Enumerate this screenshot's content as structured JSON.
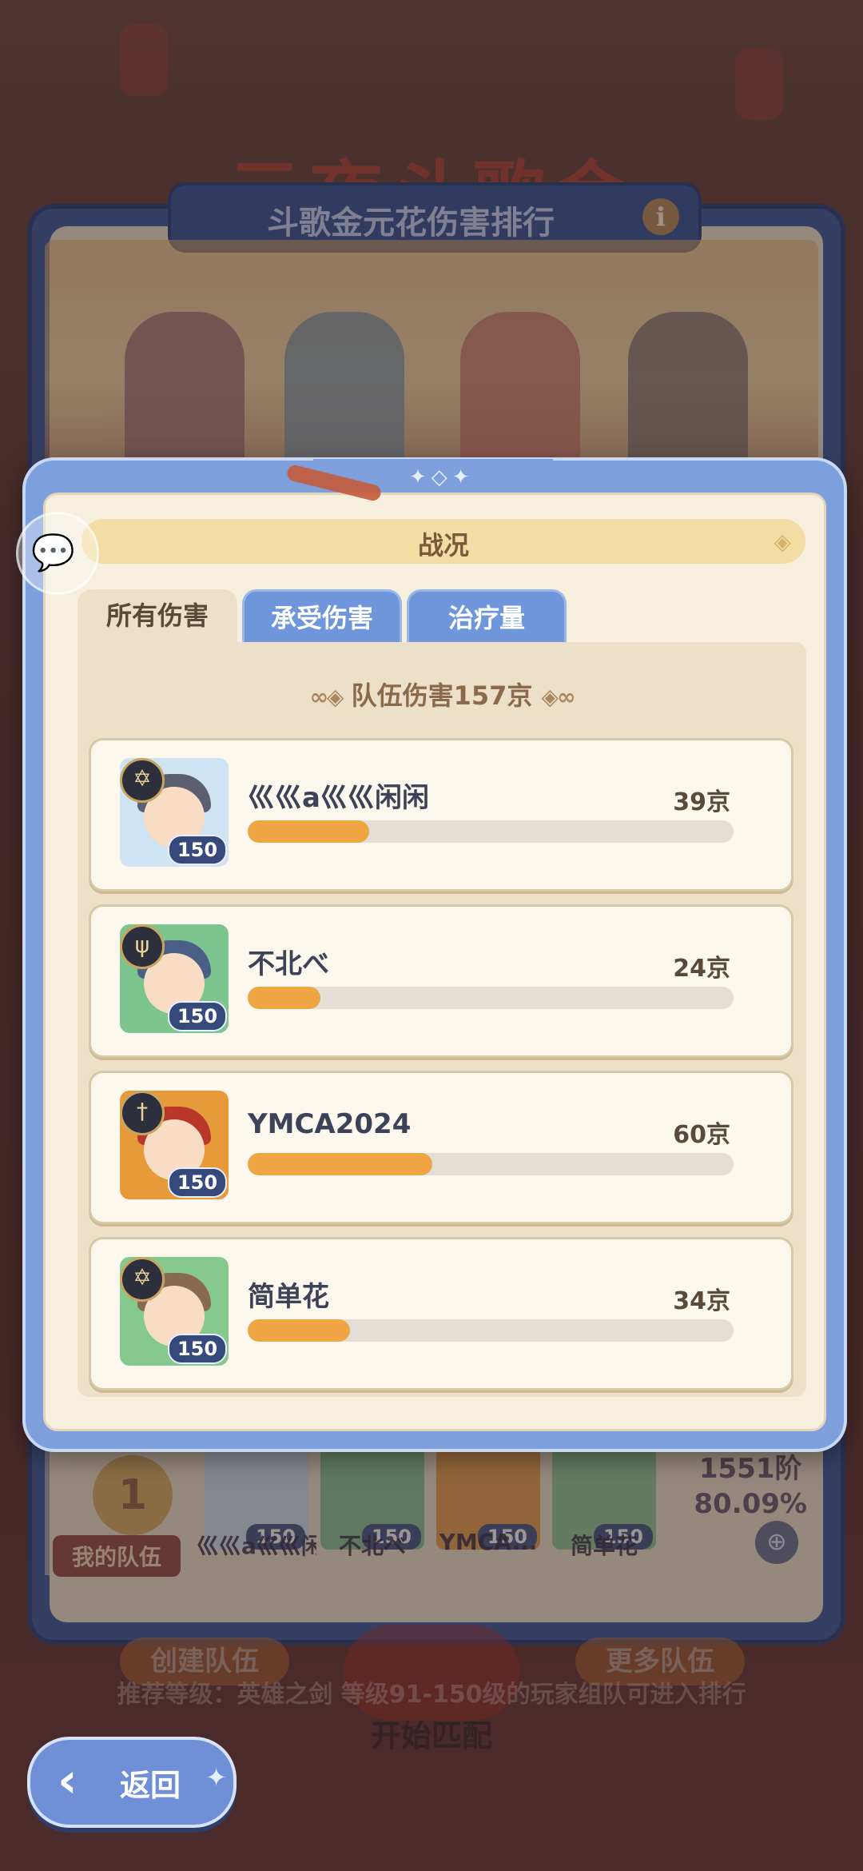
{
  "background": {
    "festival_title": "元夜斗歌会",
    "ranking_panel_title": "斗歌金元花伤害排行",
    "my_team": {
      "rank": "1",
      "label": "我的队伍",
      "score_tier": "1551阶",
      "score_percent": "80.09%",
      "members": [
        {
          "name": "⼮⼮a⼮⼮闲...",
          "level": "150"
        },
        {
          "name": "不北べ",
          "level": "150"
        },
        {
          "name": "YMCA...",
          "level": "150"
        },
        {
          "name": "简单花",
          "level": "150"
        }
      ]
    },
    "create_team_label": "创建队伍",
    "more_teams_label": "更多队伍",
    "hint_text": "推荐等级：英雄之剑 等级91-150级的玩家组队可进入排行",
    "start_match_label": "开始匹配"
  },
  "modal": {
    "title": "战况",
    "tabs": [
      {
        "label": "所有伤害",
        "active": true
      },
      {
        "label": "承受伤害",
        "active": false
      },
      {
        "label": "治疗量",
        "active": false
      }
    ],
    "team_total": "队伍伤害157京",
    "members": [
      {
        "name": "⼮⼮a⼮⼮闲闲",
        "level": "150",
        "damage": "39京",
        "fraction": 0.25,
        "class_icon": "magic-hexagram-icon",
        "hair_color": "#5c5f70",
        "bg_color": "#cfe4f2"
      },
      {
        "name": "不北べ",
        "level": "150",
        "damage": "24京",
        "fraction": 0.15,
        "class_icon": "trident-icon",
        "hair_color": "#4b5f86",
        "bg_color": "#7cc58e"
      },
      {
        "name": "YMCA2024",
        "level": "150",
        "damage": "60京",
        "fraction": 0.38,
        "class_icon": "sword-icon",
        "hair_color": "#b8362a",
        "bg_color": "#e79a3a"
      },
      {
        "name": "简单花",
        "level": "150",
        "damage": "34京",
        "fraction": 0.21,
        "class_icon": "magic-hexagram-icon",
        "hair_color": "#8a6a52",
        "bg_color": "#85c98f"
      }
    ]
  },
  "back_button_label": "返回",
  "colors": {
    "bar_fill": "#f0a545",
    "bar_track": "#e4dfd6",
    "modal_frame": "#7d9fdc",
    "tab_inactive": "#6f96db"
  }
}
